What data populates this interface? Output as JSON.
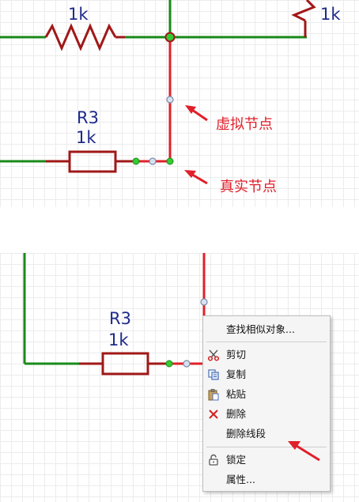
{
  "top_panel": {
    "resistor_top_value": "1k",
    "resistor_right_value": "1k",
    "r3_designator": "R3",
    "r3_value": "1k",
    "callout_virtual_node": "虚拟节点",
    "callout_real_node": "真实节点"
  },
  "bottom_panel": {
    "r3_designator": "R3",
    "r3_value": "1k"
  },
  "context_menu": {
    "find_similar": "查找相似对象...",
    "cut": "剪切",
    "copy": "复制",
    "paste": "粘贴",
    "delete": "删除",
    "delete_segment": "删除线段",
    "lock": "锁定",
    "properties": "属性..."
  },
  "icons": {
    "cut": "scissors-icon",
    "copy": "copy-icon",
    "paste": "paste-icon",
    "delete": "delete-x-icon",
    "lock": "lock-icon"
  },
  "colors": {
    "wire_green": "#1a8a1a",
    "wire_red": "#e0202a",
    "resistor_red": "#a01818",
    "label_blue": "#1f2a8a",
    "annotation_red": "#e0202a",
    "node_green": "#33cc33",
    "node_virtual_fill": "#d8e2f2"
  }
}
